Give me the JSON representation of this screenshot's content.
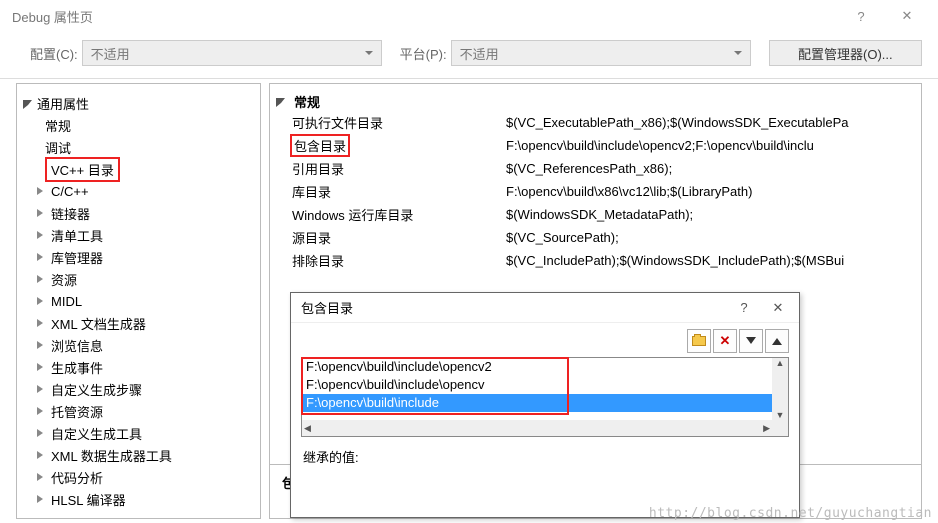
{
  "window": {
    "title": "Debug 属性页",
    "help_symbol": "?",
    "close_symbol": "✕"
  },
  "toolbar": {
    "config_label": "配置(C):",
    "config_value": "不适用",
    "platform_label": "平台(P):",
    "platform_value": "不适用",
    "manager_button": "配置管理器(O)..."
  },
  "tree": {
    "root": "通用属性",
    "items": [
      {
        "label": "常规",
        "triangle": false
      },
      {
        "label": "调试",
        "triangle": false
      },
      {
        "label": "VC++ 目录",
        "triangle": false,
        "selected": true
      },
      {
        "label": "C/C++",
        "triangle": true
      },
      {
        "label": "链接器",
        "triangle": true
      },
      {
        "label": "清单工具",
        "triangle": true
      },
      {
        "label": "库管理器",
        "triangle": true
      },
      {
        "label": "资源",
        "triangle": true
      },
      {
        "label": "MIDL",
        "triangle": true
      },
      {
        "label": "XML 文档生成器",
        "triangle": true
      },
      {
        "label": "浏览信息",
        "triangle": true
      },
      {
        "label": "生成事件",
        "triangle": true
      },
      {
        "label": "自定义生成步骤",
        "triangle": true
      },
      {
        "label": "托管资源",
        "triangle": true
      },
      {
        "label": "自定义生成工具",
        "triangle": true
      },
      {
        "label": "XML 数据生成器工具",
        "triangle": true
      },
      {
        "label": "代码分析",
        "triangle": true
      },
      {
        "label": "HLSL 编译器",
        "triangle": true
      }
    ]
  },
  "props": {
    "section": "常规",
    "rows": [
      {
        "label": "可执行文件目录",
        "value": "$(VC_ExecutablePath_x86);$(WindowsSDK_ExecutablePa"
      },
      {
        "label": "包含目录",
        "value": "F:\\opencv\\build\\include\\opencv2;F:\\opencv\\build\\inclu",
        "highlight": true
      },
      {
        "label": "引用目录",
        "value": "$(VC_ReferencesPath_x86);"
      },
      {
        "label": "库目录",
        "value": "F:\\opencv\\build\\x86\\vc12\\lib;$(LibraryPath)"
      },
      {
        "label": "Windows 运行库目录",
        "value": "$(WindowsSDK_MetadataPath);"
      },
      {
        "label": "源目录",
        "value": "$(VC_SourcePath);"
      },
      {
        "label": "排除目录",
        "value": "$(VC_IncludePath);$(WindowsSDK_IncludePath);$(MSBui"
      }
    ],
    "bottom_section": "包含"
  },
  "popup": {
    "title": "包含目录",
    "help_symbol": "?",
    "close_symbol": "✕",
    "items": [
      "F:\\opencv\\build\\include\\opencv2",
      "F:\\opencv\\build\\include\\opencv",
      "F:\\opencv\\build\\include"
    ],
    "selected_index": 2,
    "inherited_label": "继承的值:"
  },
  "watermark": "http://blog.csdn.net/guyuchangtian"
}
